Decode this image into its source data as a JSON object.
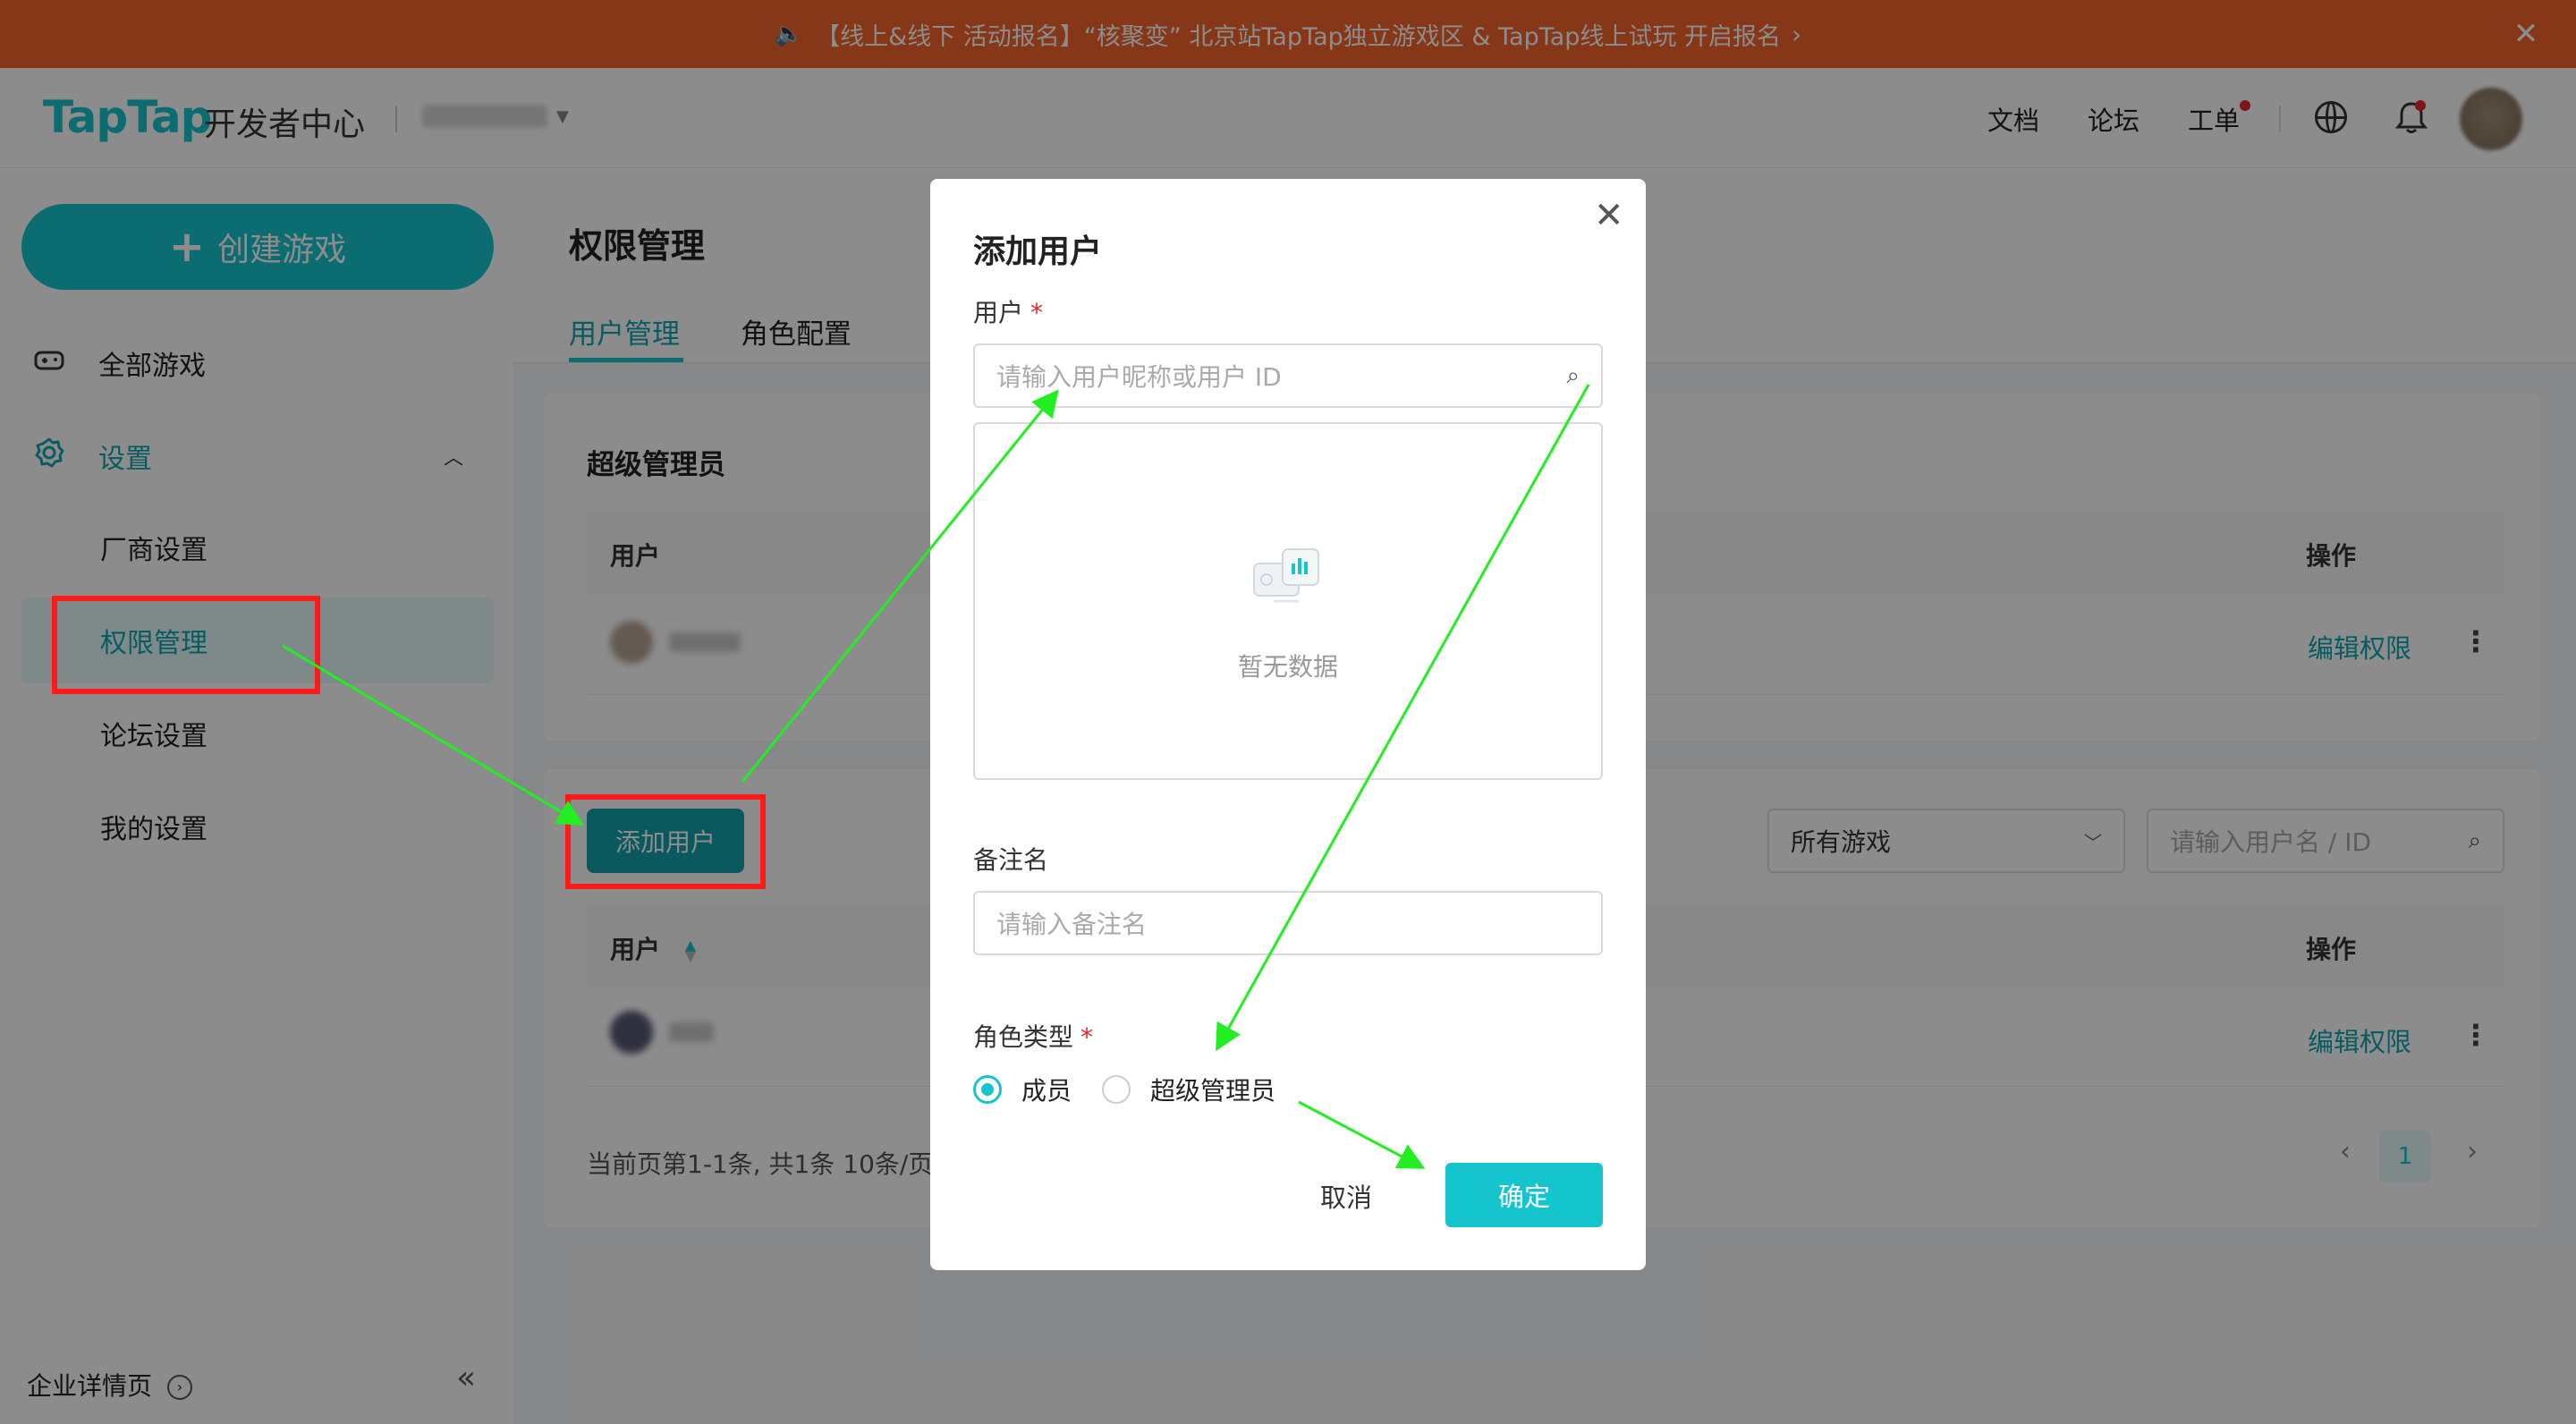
{
  "banner": {
    "text": "【线上&线下 活动报名】“核聚变” 北京站TapTap独立游戏区 & TapTap线上试玩 开启报名",
    "close_label": "✕"
  },
  "topnav": {
    "logo": "TapTap",
    "logo_sub": "开发者中心",
    "links": {
      "docs": "文档",
      "forum": "论坛",
      "ticket": "工单"
    }
  },
  "sidebar": {
    "create_label": "创建游戏",
    "all_games": "全部游戏",
    "settings": "设置",
    "sub_items": [
      "厂商设置",
      "权限管理",
      "论坛设置",
      "我的设置"
    ],
    "footer": "企业详情页"
  },
  "main": {
    "page_title": "权限管理",
    "tabs": [
      "用户管理",
      "角色配置"
    ],
    "super_admin_title": "超级管理员",
    "table_user_header": "用户",
    "table_action_header": "操作",
    "edit_permission": "编辑权限",
    "add_user_button": "添加用户",
    "game_filter": "所有游戏",
    "search_placeholder": "请输入用户名 / ID",
    "pager_info": "当前页第1-1条, 共1条   10条/页",
    "current_page": "1"
  },
  "modal": {
    "title": "添加用户",
    "user_label": "用户",
    "user_placeholder": "请输入用户昵称或用户 ID",
    "empty_text": "暂无数据",
    "remark_label": "备注名",
    "remark_placeholder": "请输入备注名",
    "role_label": "角色类型",
    "role_options": [
      "成员",
      "超级管理员"
    ],
    "cancel_label": "取消",
    "confirm_label": "确定"
  },
  "colors": {
    "brand": "#15c5ce",
    "banner": "#f5652a",
    "annotation_red": "#ff1a1a",
    "annotation_green": "#22ee22"
  }
}
